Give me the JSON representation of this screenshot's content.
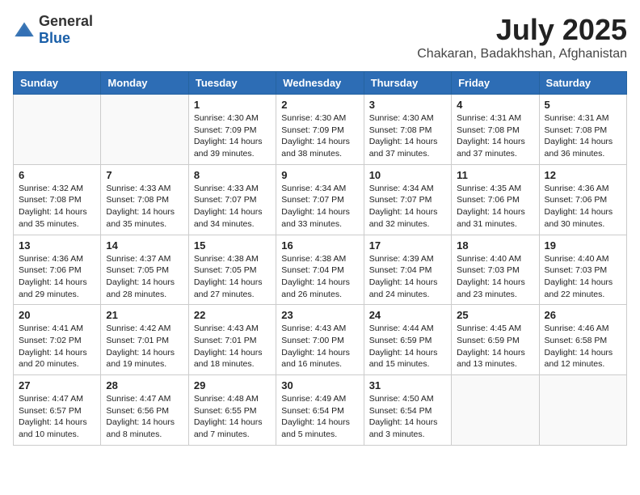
{
  "logo": {
    "general": "General",
    "blue": "Blue"
  },
  "title": "July 2025",
  "subtitle": "Chakaran, Badakhshan, Afghanistan",
  "days_of_week": [
    "Sunday",
    "Monday",
    "Tuesday",
    "Wednesday",
    "Thursday",
    "Friday",
    "Saturday"
  ],
  "weeks": [
    [
      {
        "day": "",
        "content": ""
      },
      {
        "day": "",
        "content": ""
      },
      {
        "day": "1",
        "content": "Sunrise: 4:30 AM\nSunset: 7:09 PM\nDaylight: 14 hours and 39 minutes."
      },
      {
        "day": "2",
        "content": "Sunrise: 4:30 AM\nSunset: 7:09 PM\nDaylight: 14 hours and 38 minutes."
      },
      {
        "day": "3",
        "content": "Sunrise: 4:30 AM\nSunset: 7:08 PM\nDaylight: 14 hours and 37 minutes."
      },
      {
        "day": "4",
        "content": "Sunrise: 4:31 AM\nSunset: 7:08 PM\nDaylight: 14 hours and 37 minutes."
      },
      {
        "day": "5",
        "content": "Sunrise: 4:31 AM\nSunset: 7:08 PM\nDaylight: 14 hours and 36 minutes."
      }
    ],
    [
      {
        "day": "6",
        "content": "Sunrise: 4:32 AM\nSunset: 7:08 PM\nDaylight: 14 hours and 35 minutes."
      },
      {
        "day": "7",
        "content": "Sunrise: 4:33 AM\nSunset: 7:08 PM\nDaylight: 14 hours and 35 minutes."
      },
      {
        "day": "8",
        "content": "Sunrise: 4:33 AM\nSunset: 7:07 PM\nDaylight: 14 hours and 34 minutes."
      },
      {
        "day": "9",
        "content": "Sunrise: 4:34 AM\nSunset: 7:07 PM\nDaylight: 14 hours and 33 minutes."
      },
      {
        "day": "10",
        "content": "Sunrise: 4:34 AM\nSunset: 7:07 PM\nDaylight: 14 hours and 32 minutes."
      },
      {
        "day": "11",
        "content": "Sunrise: 4:35 AM\nSunset: 7:06 PM\nDaylight: 14 hours and 31 minutes."
      },
      {
        "day": "12",
        "content": "Sunrise: 4:36 AM\nSunset: 7:06 PM\nDaylight: 14 hours and 30 minutes."
      }
    ],
    [
      {
        "day": "13",
        "content": "Sunrise: 4:36 AM\nSunset: 7:06 PM\nDaylight: 14 hours and 29 minutes."
      },
      {
        "day": "14",
        "content": "Sunrise: 4:37 AM\nSunset: 7:05 PM\nDaylight: 14 hours and 28 minutes."
      },
      {
        "day": "15",
        "content": "Sunrise: 4:38 AM\nSunset: 7:05 PM\nDaylight: 14 hours and 27 minutes."
      },
      {
        "day": "16",
        "content": "Sunrise: 4:38 AM\nSunset: 7:04 PM\nDaylight: 14 hours and 26 minutes."
      },
      {
        "day": "17",
        "content": "Sunrise: 4:39 AM\nSunset: 7:04 PM\nDaylight: 14 hours and 24 minutes."
      },
      {
        "day": "18",
        "content": "Sunrise: 4:40 AM\nSunset: 7:03 PM\nDaylight: 14 hours and 23 minutes."
      },
      {
        "day": "19",
        "content": "Sunrise: 4:40 AM\nSunset: 7:03 PM\nDaylight: 14 hours and 22 minutes."
      }
    ],
    [
      {
        "day": "20",
        "content": "Sunrise: 4:41 AM\nSunset: 7:02 PM\nDaylight: 14 hours and 20 minutes."
      },
      {
        "day": "21",
        "content": "Sunrise: 4:42 AM\nSunset: 7:01 PM\nDaylight: 14 hours and 19 minutes."
      },
      {
        "day": "22",
        "content": "Sunrise: 4:43 AM\nSunset: 7:01 PM\nDaylight: 14 hours and 18 minutes."
      },
      {
        "day": "23",
        "content": "Sunrise: 4:43 AM\nSunset: 7:00 PM\nDaylight: 14 hours and 16 minutes."
      },
      {
        "day": "24",
        "content": "Sunrise: 4:44 AM\nSunset: 6:59 PM\nDaylight: 14 hours and 15 minutes."
      },
      {
        "day": "25",
        "content": "Sunrise: 4:45 AM\nSunset: 6:59 PM\nDaylight: 14 hours and 13 minutes."
      },
      {
        "day": "26",
        "content": "Sunrise: 4:46 AM\nSunset: 6:58 PM\nDaylight: 14 hours and 12 minutes."
      }
    ],
    [
      {
        "day": "27",
        "content": "Sunrise: 4:47 AM\nSunset: 6:57 PM\nDaylight: 14 hours and 10 minutes."
      },
      {
        "day": "28",
        "content": "Sunrise: 4:47 AM\nSunset: 6:56 PM\nDaylight: 14 hours and 8 minutes."
      },
      {
        "day": "29",
        "content": "Sunrise: 4:48 AM\nSunset: 6:55 PM\nDaylight: 14 hours and 7 minutes."
      },
      {
        "day": "30",
        "content": "Sunrise: 4:49 AM\nSunset: 6:54 PM\nDaylight: 14 hours and 5 minutes."
      },
      {
        "day": "31",
        "content": "Sunrise: 4:50 AM\nSunset: 6:54 PM\nDaylight: 14 hours and 3 minutes."
      },
      {
        "day": "",
        "content": ""
      },
      {
        "day": "",
        "content": ""
      }
    ]
  ]
}
